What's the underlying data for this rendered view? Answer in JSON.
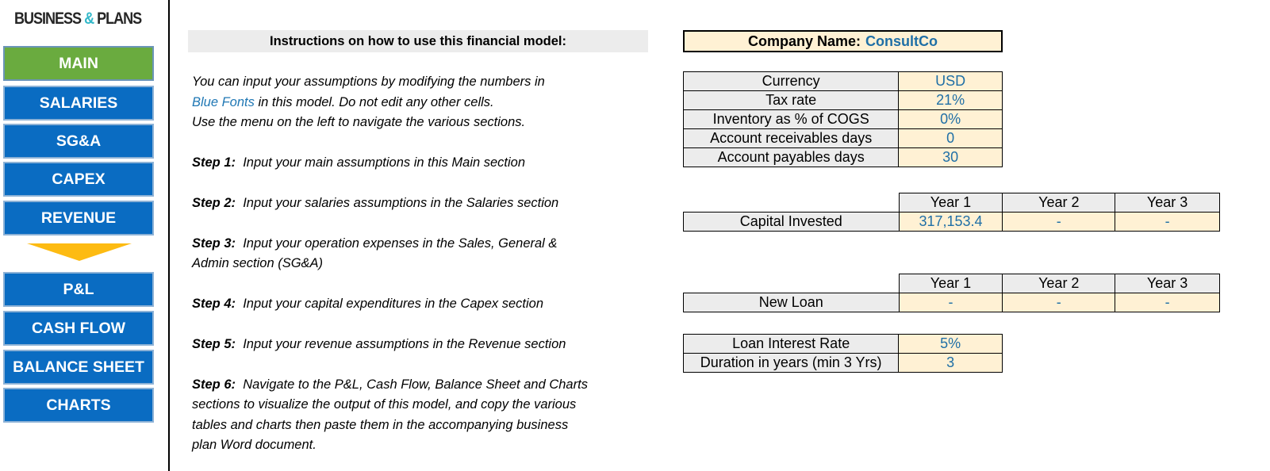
{
  "logo": {
    "part1": "BUSINESS",
    "amp": "&",
    "part2": "PLANS"
  },
  "nav": {
    "items": [
      {
        "label": "MAIN",
        "active": true
      },
      {
        "label": "SALARIES"
      },
      {
        "label": "SG&A"
      },
      {
        "label": "CAPEX"
      },
      {
        "label": "REVENUE"
      },
      {
        "label": "P&L"
      },
      {
        "label": "CASH FLOW"
      },
      {
        "label": "BALANCE SHEET"
      },
      {
        "label": "CHARTS"
      }
    ],
    "arrow_icon": "down-arrow-icon",
    "colors": {
      "button": "#0a6cc2",
      "active": "#6aab3f",
      "arrow": "#fdbb12"
    }
  },
  "instructions": {
    "title": "Instructions on how to use this financial model:",
    "intro": [
      "You can input your assumptions by modifying the numbers in",
      {
        "blue": "Blue Fonts",
        "rest": " in this model. Do not edit any other cells."
      },
      "Use the menu on the left to navigate the various sections."
    ],
    "steps": [
      {
        "label": "Step 1:",
        "lines": [
          "Input your main assumptions in this Main section"
        ]
      },
      {
        "label": "Step 2:",
        "lines": [
          "Input your salaries assumptions in the Salaries section"
        ]
      },
      {
        "label": "Step 3:",
        "lines": [
          "Input your operation expenses in the Sales, General &",
          "Admin section (SG&A)"
        ]
      },
      {
        "label": "Step 4:",
        "lines": [
          "Input your capital expenditures in the Capex section"
        ]
      },
      {
        "label": "Step 5:",
        "lines": [
          "Input your revenue assumptions in the Revenue section"
        ]
      },
      {
        "label": "Step 6:",
        "lines": [
          "Navigate to the P&L, Cash Flow, Balance Sheet and Charts",
          "sections to visualize the output of this model, and copy the various",
          "tables and charts then paste them in the accompanying business",
          "plan Word document."
        ]
      }
    ]
  },
  "company": {
    "label": "Company Name:",
    "value": "ConsultCo"
  },
  "assumptions": [
    {
      "label": "Currency",
      "value": "USD"
    },
    {
      "label": "Tax rate",
      "value": "21%"
    },
    {
      "label": "Inventory as % of COGS",
      "value": "0%"
    },
    {
      "label": "Account receivables days",
      "value": "0"
    },
    {
      "label": "Account payables days",
      "value": "30"
    }
  ],
  "capital": {
    "years": [
      "Year 1",
      "Year 2",
      "Year 3"
    ],
    "label": "Capital Invested",
    "values": [
      "317,153.4",
      "-",
      "-"
    ]
  },
  "loan": {
    "years": [
      "Year 1",
      "Year 2",
      "Year 3"
    ],
    "label": "New Loan",
    "values": [
      "-",
      "-",
      "-"
    ]
  },
  "loan_terms": [
    {
      "label": "Loan Interest Rate",
      "value": "5%"
    },
    {
      "label": "Duration in years (min 3 Yrs)",
      "value": "3"
    }
  ],
  "colors": {
    "input_fill": "#fff1d4",
    "input_font": "#1f6fa6",
    "label_fill": "#ececec"
  }
}
